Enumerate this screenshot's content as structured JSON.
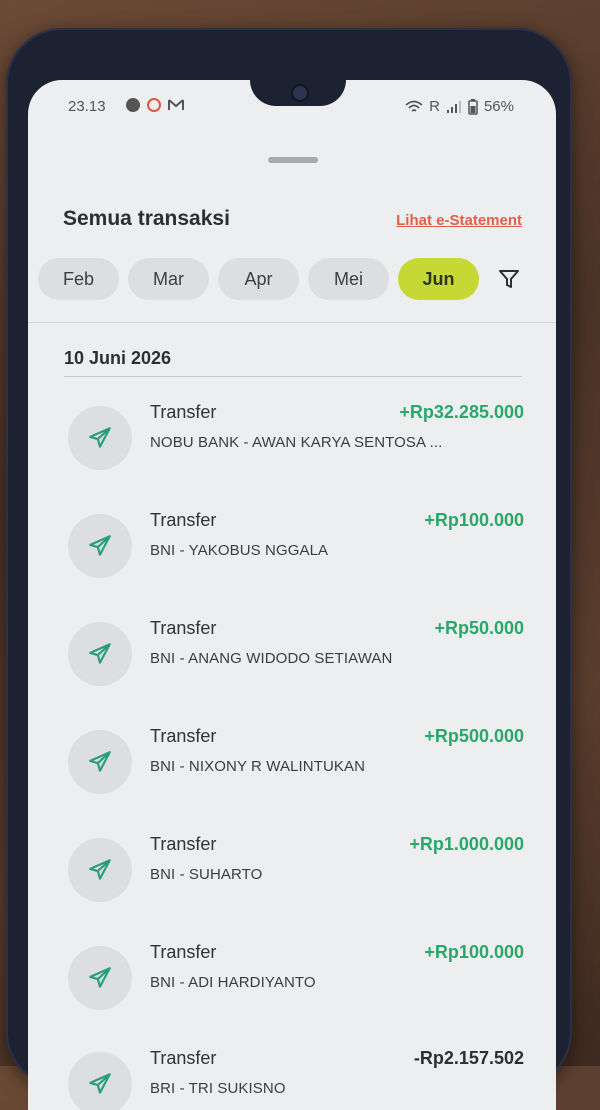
{
  "status_bar": {
    "time": "23.13",
    "network": "R",
    "battery": "56%"
  },
  "header": {
    "title": "Semua transaksi",
    "estatement_link": "Lihat e-Statement"
  },
  "months": [
    {
      "label": "Feb",
      "active": false
    },
    {
      "label": "Mar",
      "active": false
    },
    {
      "label": "Apr",
      "active": false
    },
    {
      "label": "Mei",
      "active": false
    },
    {
      "label": "Jun",
      "active": true
    }
  ],
  "date_group": "10 Juni 2026",
  "transactions": [
    {
      "type": "Transfer",
      "name": "NOBU BANK - AWAN KARYA SENTOSA ...",
      "amount": "+Rp32.285.000"
    },
    {
      "type": "Transfer",
      "name": "BNI - YAKOBUS NGGALA",
      "amount": "+Rp100.000"
    },
    {
      "type": "Transfer",
      "name": "BNI - ANANG WIDODO SETIAWAN",
      "amount": "+Rp50.000"
    },
    {
      "type": "Transfer",
      "name": "BNI - NIXONY R WALINTUKAN",
      "amount": "+Rp500.000"
    },
    {
      "type": "Transfer",
      "name": "BNI - SUHARTO",
      "amount": "+Rp1.000.000"
    },
    {
      "type": "Transfer",
      "name": "BNI - ADI HARDIYANTO",
      "amount": "+Rp100.000"
    },
    {
      "type": "Transfer",
      "name": "BRI - TRI SUKISNO",
      "amount": "-Rp2.157.502"
    }
  ],
  "colors": {
    "accent": "#c6d833",
    "credit": "#2aa86a",
    "link": "#e2604a"
  }
}
